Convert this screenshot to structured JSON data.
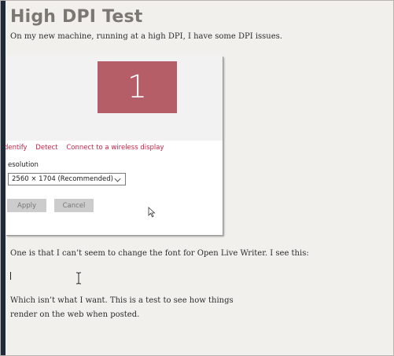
{
  "post": {
    "title": "High DPI Test",
    "paragraph1": "On my new machine, running at a high DPI, I have some DPI issues.",
    "paragraph2": "One is that I can’t seem to change the font for Open Live Writer. I see this:",
    "paragraph3": "Which isn’t what I want. This is a test to see how things render on the web when posted."
  },
  "display_settings": {
    "monitor_number": "1",
    "monitor_color": "#b65e68",
    "links": [
      "dentify",
      "Detect",
      "Connect to a wireless display"
    ],
    "resolution_label": "esolution",
    "resolution_value": "2560 × 1704 (Recommended)",
    "apply_label": "Apply",
    "cancel_label": "Cancel"
  },
  "icons": [
    "mouse-pointer-icon",
    "text-ibeam-icon",
    "chevron-down-icon"
  ],
  "colors": {
    "link": "#cc2245",
    "background": "#f2f0ed",
    "title": "#7b7772"
  }
}
